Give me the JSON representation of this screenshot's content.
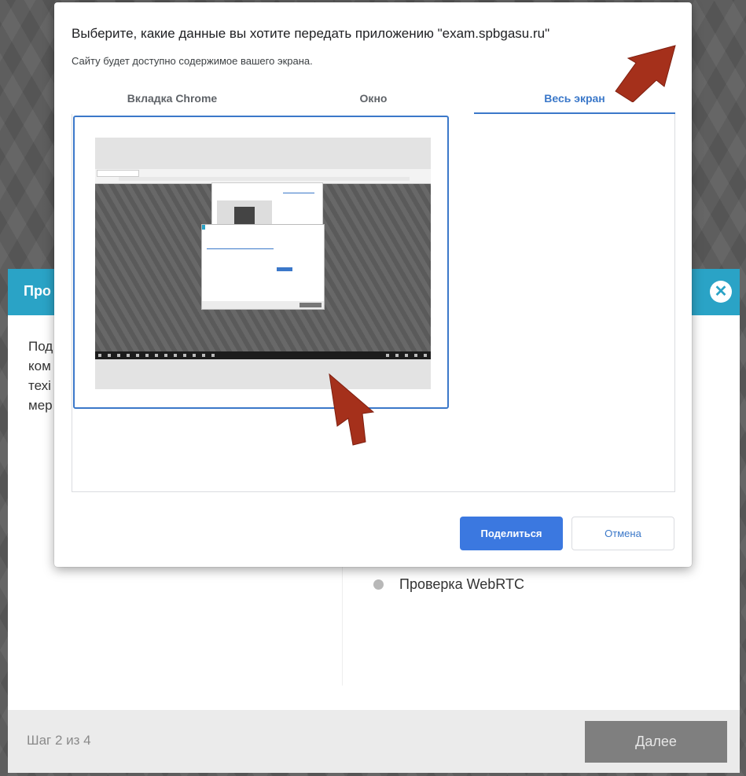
{
  "wizard": {
    "title": "Про",
    "close_icon": "close-icon",
    "text_lines": [
      "Под",
      "ком",
      "техі",
      "мер"
    ],
    "checks": [
      {
        "label": "Проверка WebRTC",
        "status_color": "#b8b8b8"
      }
    ],
    "step": "Шаг 2 из 4",
    "next_label": "Далее",
    "accent_color": "#2aa3c6"
  },
  "share_dialog": {
    "title": "Выберите, какие данные вы хотите передать приложению \"exam.spbgasu.ru\"",
    "subtitle": "Сайту будет доступно содержимое вашего экрана.",
    "tabs": [
      {
        "label": "Вкладка Chrome",
        "active": false
      },
      {
        "label": "Окно",
        "active": false
      },
      {
        "label": "Весь экран",
        "active": true
      }
    ],
    "share_label": "Поделиться",
    "cancel_label": "Отмена",
    "accent_color": "#3b78c9"
  },
  "annotations": {
    "arrow_color": "#a5301b",
    "arrows": [
      "arrow-to-fullscreen-tab",
      "arrow-to-screen-thumbnail"
    ]
  }
}
